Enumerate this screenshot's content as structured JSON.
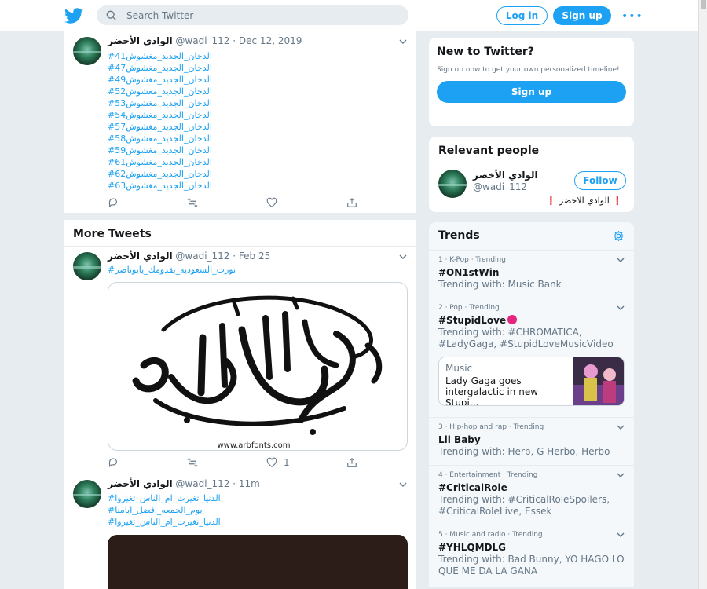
{
  "header": {
    "search_placeholder": "Search Twitter",
    "login_label": "Log in",
    "signup_label": "Sign up",
    "more_label": "•••"
  },
  "colors": {
    "brand": "#1da1f2",
    "background": "#e6ecf0",
    "muted": "#657786"
  },
  "pinned_tweet": {
    "name": "الوادي الأخضر",
    "handle": "@wadi_112",
    "date": "· Dec 12, 2019",
    "lines": [
      "#الدخان_الجديد_مغشوش41",
      "#الدخان_الجديد_مغشوش47",
      "#الدخان_الجديد_مغشوش49",
      "#الدخان_الجديد_مغشوش52",
      "#الدخان_الجديد_مغشوش53",
      "#الدخان_الجديد_مغشوش54",
      "#الدخان_الجديد_مغشوش57",
      "#الدخان_الجديد_مغشوش58",
      "#الدخان_الجديد_مغشوش59",
      "#الدخان_الجديد_مغشوش61",
      "#الدخان_الجديد_مغشوش62",
      "#الدخان_الجديد_مغشوش63"
    ]
  },
  "more_tweets": {
    "title": "More Tweets",
    "tweets": [
      {
        "name": "الوادي الأخضر",
        "handle": "@wadi_112",
        "date": "· Feb 25",
        "lines": [
          "#نورت_السعوديه_بقدومك_يابوناصر"
        ],
        "like_count": "1",
        "media_caption": "www.arbfonts.com"
      },
      {
        "name": "الوادي الأخضر",
        "handle": "@wadi_112",
        "date": "· 11m",
        "lines": [
          "#الدنيا_تغيرت_ام_الناس_تغيروا",
          "#يوم_الجمعه_افضل_ايامنا",
          "#الدنيا_تغيرت_ام_الناس_تغيروا"
        ]
      }
    ]
  },
  "sidebar": {
    "new_to_twitter": {
      "title": "New to Twitter?",
      "text": "Sign up now to get your own personalized timeline!",
      "button": "Sign up"
    },
    "relevant_people": {
      "title": "Relevant people",
      "name": "الوادي الأخضر",
      "handle": "@wadi_112",
      "follow": "Follow",
      "bio": "الوادي الاخضر"
    },
    "trends": {
      "title": "Trends",
      "items": [
        {
          "ctx": "1 · K-Pop · Trending",
          "name": "#ON1stWin",
          "with": "Trending with: Music Bank"
        },
        {
          "ctx": "2 · Pop · Trending",
          "name": "#StupidLove",
          "with": "Trending with: #CHROMATICA, #LadyGaga, #StupidLoveMusicVideo",
          "news_category": "Music",
          "news_title": "Lady Gaga goes intergalactic in new Stupi..."
        },
        {
          "ctx": "3 · Hip-hop and rap · Trending",
          "name": "Lil Baby",
          "with": "Trending with: Herb, G Herbo, Herbo"
        },
        {
          "ctx": "4 · Entertainment · Trending",
          "name": "#CriticalRole",
          "with": "Trending with: #CriticalRoleSpoilers, #CriticalRoleLive, Essek"
        },
        {
          "ctx": "5 · Music and radio · Trending",
          "name": "#YHLQMDLG",
          "with": "Trending with: Bad Bunny, YO HAGO LO QUE ME DA LA GANA"
        }
      ]
    }
  }
}
